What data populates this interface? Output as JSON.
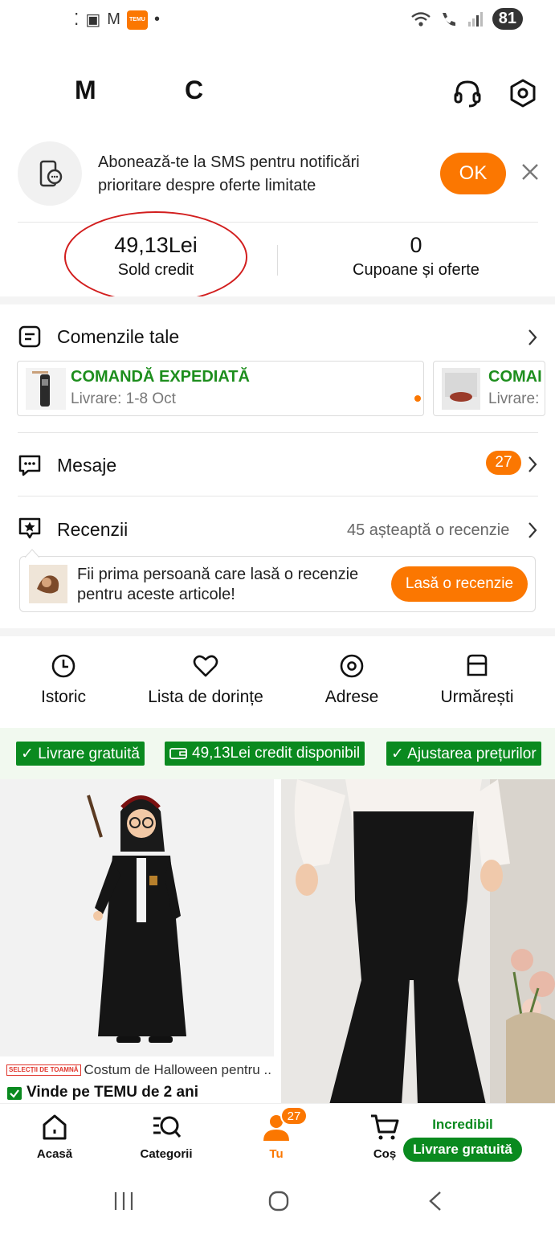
{
  "status_bar": {
    "left_glyphs": [
      "⁚",
      "▣",
      "M"
    ],
    "temu_mini": "TEMU",
    "dot": "•",
    "battery": "81"
  },
  "header": {
    "initial_1": "M",
    "initial_2": "C"
  },
  "sms_banner": {
    "text": "Abonează-te la SMS pentru notificări prioritare despre oferte limitate",
    "ok_label": "OK"
  },
  "credit": {
    "value": "49,13Lei",
    "label": "Sold credit"
  },
  "coupons": {
    "value": "0",
    "label": "Cupoane și oferte"
  },
  "orders": {
    "title": "Comenzile tale",
    "cards": [
      {
        "status": "COMANDĂ EXPEDIATĂ",
        "delivery": "Livrare: 1-8 Oct"
      },
      {
        "status": "COMAI",
        "delivery": "Livrare:"
      }
    ]
  },
  "messages": {
    "title": "Mesaje",
    "count": "27"
  },
  "reviews": {
    "title": "Recenzii",
    "pending": "45 așteaptă o recenzie",
    "prompt": "Fii prima persoană care lasă o recenzie pentru aceste articole!",
    "button": "Lasă o recenzie"
  },
  "quick_links": [
    {
      "label": "Istoric",
      "icon": "clock-icon"
    },
    {
      "label": "Lista de dorințe",
      "icon": "heart-icon"
    },
    {
      "label": "Adrese",
      "icon": "location-icon"
    },
    {
      "label": "Urmărești",
      "icon": "store-icon"
    }
  ],
  "promo_chips": [
    "✓ Livrare gratuită",
    "49,13Lei credit disponibil",
    "✓ Ajustarea prețurilor"
  ],
  "products": [
    {
      "tag": "SELECȚII DE TOAMNĂ",
      "title": "Costum de Halloween pentru ...",
      "seller": "Vinde pe TEMU de 2 ani"
    }
  ],
  "bottom_nav": {
    "items": [
      {
        "label": "Acasă"
      },
      {
        "label": "Categorii"
      },
      {
        "label": "Tu"
      },
      {
        "label": "Coș"
      }
    ],
    "you_badge": "27",
    "promo_top": "Incredibil",
    "promo_pill": "Livrare gratuită"
  },
  "colors": {
    "accent": "#fb7701",
    "green": "#0a8a1f",
    "annotation_red": "#d21e1e"
  }
}
